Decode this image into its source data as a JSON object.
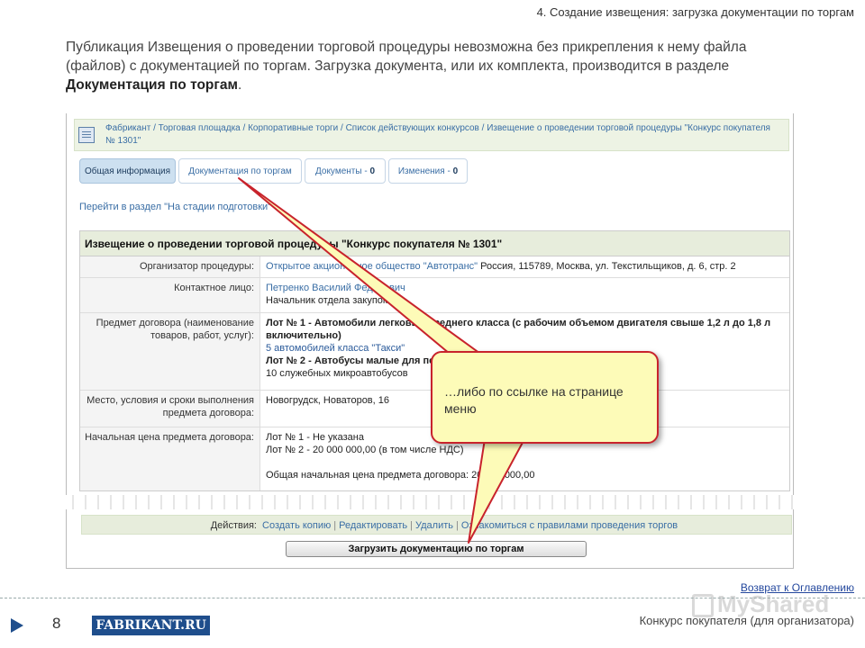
{
  "slide": {
    "title": "4. Создание извещения: загрузка документации по торгам",
    "intro_1": "Публикация Извещения о проведении торговой процедуры невозможна без прикрепления к нему файла (файлов) с документацией по торгам. Загрузка документа, или их комплекта, производится в разделе ",
    "intro_bold": "Документация по торгам",
    "intro_end": "."
  },
  "breadcrumb": "Фабрикант / Торговая площадка / Корпоративные торги / Список действующих конкурсов / Извещение о проведении торговой процедуры \"Конкурс покупателя № 1301\"",
  "tabs": [
    {
      "label": "Общая информация",
      "count": ""
    },
    {
      "label": "Документация по торгам",
      "count": ""
    },
    {
      "label": "Документы - ",
      "count": "0"
    },
    {
      "label": "Изменения - ",
      "count": "0"
    }
  ],
  "goto_link": "Перейти в раздел \"На стадии подготовки\"",
  "notice": {
    "heading": "Извещение о проведении торговой процедуры \"Конкурс покупателя № 1301\"",
    "organizer_label": "Организатор процедуры:",
    "organizer_link": "Открытое акционерное общество \"Автотранс\"",
    "organizer_addr": " Россия, 115789, Москва, ул. Текстильщиков, д. 6, стр. 2",
    "contact_label": "Контактное лицо:",
    "contact_name": "Петренко Василий Федорович",
    "contact_role": "Начальник отдела закупок",
    "subject_label": "Предмет договора (наименование товаров, работ, услуг):",
    "lot1_title": "Лот № 1 - Автомобили легковые среднего класса (с рабочим объемом двигателя свыше 1,2 л до 1,8 л включительно)",
    "lot1_desc": "5 автомобилей класса \"Такси\"",
    "lot2_title": "Лот № 2 - Автобусы малые для перевозки пассажиров",
    "lot2_desc": "10 служебных микроавтобусов",
    "place_label": "Место, условия и сроки выполнения предмета договора:",
    "place_value": "Новогрудск, Новаторов, 16",
    "price_label": "Начальная цена предмета договора:",
    "price_lot1": "Лот № 1 - Не указана",
    "price_lot2": "Лот № 2 - 20 000 000,00 (в том числе НДС)",
    "price_total": "Общая начальная цена предмета договора: 20 000 000,00"
  },
  "actions": {
    "label": "Действия:",
    "copy": "Создать копию",
    "edit": "Редактировать",
    "delete": "Удалить",
    "rules": "Ознакомиться с правилами проведения торгов",
    "upload_button": "Загрузить документацию по торгам"
  },
  "callout_text": "…либо по ссылке на странице меню",
  "footer": {
    "return_link": "Возврат к Оглавлению",
    "page_number": "8",
    "logo": "FABRIKANT.RU",
    "right_text": "Конкурс покупателя (для организатора)",
    "watermark": "MyShared"
  },
  "colors": {
    "link": "#3a6ea5",
    "callout_border": "#c8232c",
    "callout_fill": "#fdfbb8",
    "logo_bg": "#1f4e8c"
  }
}
